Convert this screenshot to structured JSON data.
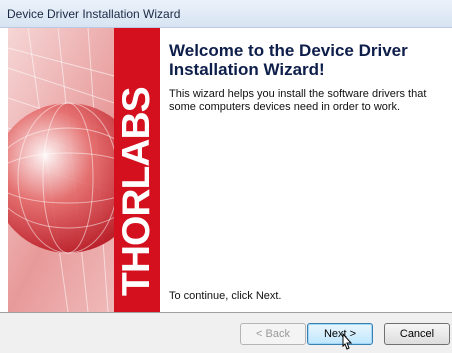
{
  "window": {
    "title": "Device Driver Installation Wizard"
  },
  "banner": {
    "brand": "THORLABS",
    "accent_color": "#d4101f"
  },
  "main": {
    "heading": "Welcome to the Device Driver Installation Wizard!",
    "description": "This wizard helps you install the software drivers that some computers devices need in order to work.",
    "continue_text": "To continue, click Next."
  },
  "buttons": {
    "back_label": "< Back",
    "next_label": "Next >",
    "cancel_label": "Cancel"
  },
  "icons": {
    "cursor": "mouse-pointer-icon"
  }
}
